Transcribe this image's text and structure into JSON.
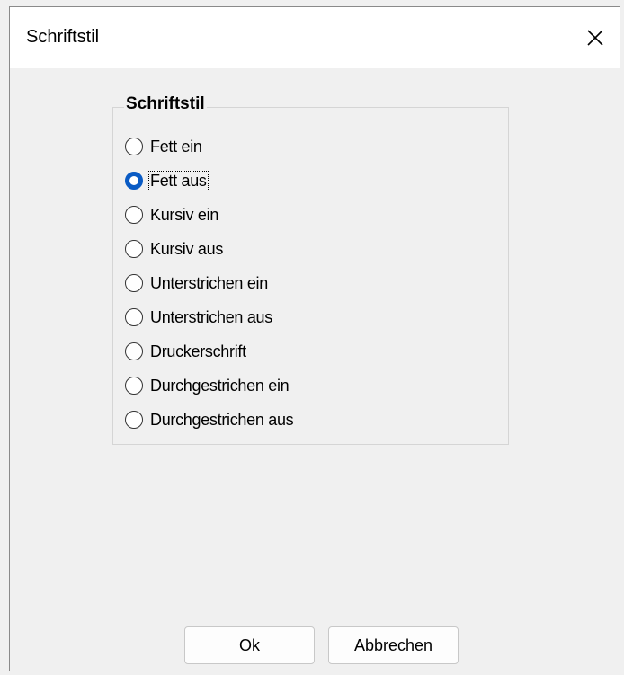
{
  "window": {
    "title": "Schriftstil",
    "close_icon": "close-icon"
  },
  "group": {
    "label": "Schriftstil",
    "options": [
      {
        "label": "Fett ein",
        "checked": false
      },
      {
        "label": "Fett aus",
        "checked": true
      },
      {
        "label": "Kursiv ein",
        "checked": false
      },
      {
        "label": "Kursiv aus",
        "checked": false
      },
      {
        "label": "Unterstrichen ein",
        "checked": false
      },
      {
        "label": "Unterstrichen aus",
        "checked": false
      },
      {
        "label": "Druckerschrift",
        "checked": false
      },
      {
        "label": "Durchgestrichen ein",
        "checked": false
      },
      {
        "label": "Durchgestrichen aus",
        "checked": false
      }
    ]
  },
  "buttons": {
    "ok_label": "Ok",
    "cancel_label": "Abbrechen"
  },
  "colors": {
    "accent": "#0a5bc4",
    "background": "#f0f0f0",
    "titlebar": "#ffffff"
  }
}
